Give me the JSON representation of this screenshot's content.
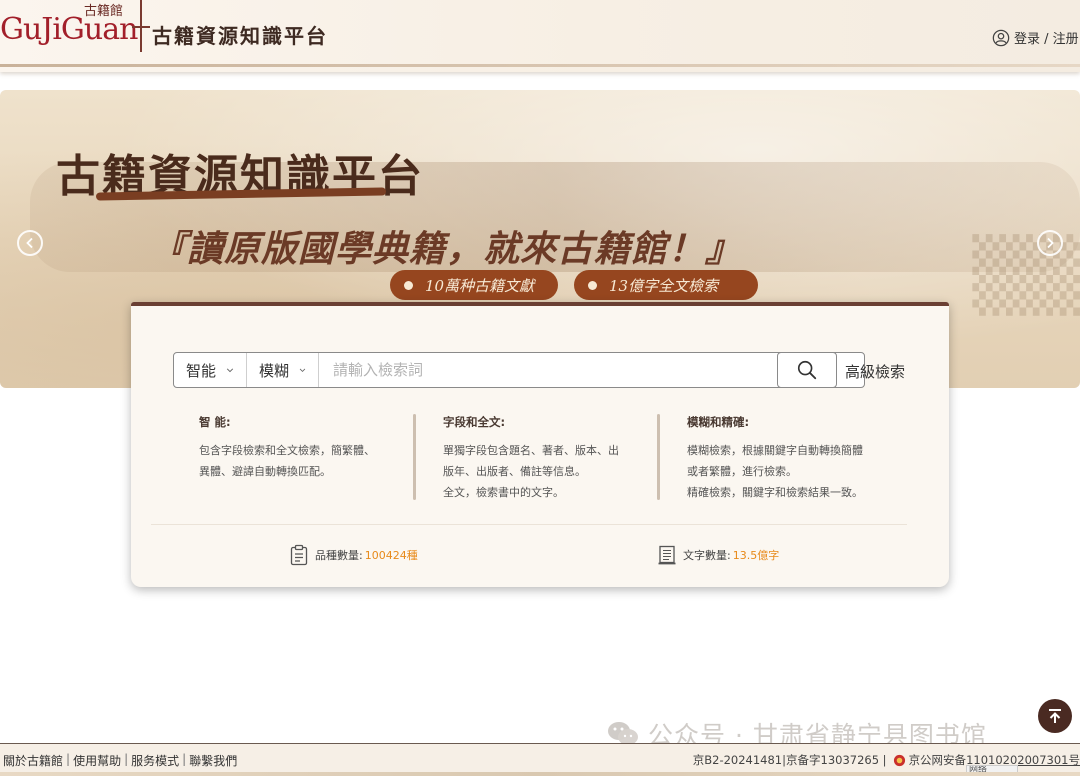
{
  "header": {
    "logo_latin": "GuJiGuan",
    "logo_small": "古籍館",
    "logo_cn": "古籍資源知識平台",
    "login_label": "登录 / 注册"
  },
  "banner": {
    "title": "古籍資源知識平台",
    "slogan": "『讀原版國學典籍，就來古籍館！』",
    "pill_1": "10萬种古籍文獻",
    "pill_2": "13億字全文檢索"
  },
  "search": {
    "mode_select": "智能",
    "match_select": "模糊",
    "placeholder": "請輸入檢索詞",
    "advanced_label": "高級檢索"
  },
  "descriptions": [
    {
      "title": "智 能:",
      "lines": [
        "包含字段檢索和全文檢索，簡繁體、",
        "異體、避諱自動轉換匹配。"
      ]
    },
    {
      "title": "字段和全文:",
      "lines": [
        "單獨字段包含題名、著者、版本、出",
        "版年、出版者、備註等信息。",
        "全文，檢索書中的文字。"
      ]
    },
    {
      "title": "模糊和精確:",
      "lines": [
        "模糊檢索，根據關鍵字自動轉換簡體",
        "或者繁體，進行檢索。",
        "精確檢索，關鍵字和檢索結果一致。"
      ]
    }
  ],
  "stats": {
    "titles_label": "品種數量:",
    "titles_value": "100424種",
    "chars_label": "文字數量:",
    "chars_value": "13.5億字"
  },
  "watermark": "公众号 · 甘肃省静宁县图书馆",
  "footer": {
    "links": [
      "關於古籍館",
      "使用幫助",
      "服务模式",
      "聯繫我們"
    ],
    "icp": "京B2-20241481|京备字13037265",
    "police_prefix": "京公网安备 ",
    "police_number": "11010202007301号",
    "net_tag": "网络"
  },
  "colors": {
    "brand_red": "#a21f2a",
    "pill_brown": "#96461f",
    "accent_orange": "#e88a1a",
    "panel_border": "#6a3f33"
  }
}
